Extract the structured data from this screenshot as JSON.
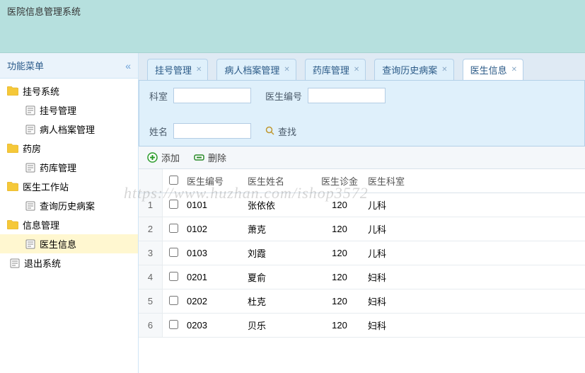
{
  "app_title": "医院信息管理系统",
  "sidebar": {
    "title": "功能菜单",
    "nodes": [
      {
        "label": "挂号系统",
        "type": "folder"
      },
      {
        "label": "挂号管理",
        "type": "leaf"
      },
      {
        "label": "病人档案管理",
        "type": "leaf"
      },
      {
        "label": "药房",
        "type": "folder"
      },
      {
        "label": "药库管理",
        "type": "leaf"
      },
      {
        "label": "医生工作站",
        "type": "folder"
      },
      {
        "label": "查询历史病案",
        "type": "leaf"
      },
      {
        "label": "信息管理",
        "type": "folder"
      },
      {
        "label": "医生信息",
        "type": "leaf",
        "selected": true
      },
      {
        "label": "退出系统",
        "type": "leaf-root"
      }
    ]
  },
  "tabs": [
    {
      "label": "挂号管理"
    },
    {
      "label": "病人档案管理"
    },
    {
      "label": "药库管理"
    },
    {
      "label": "查询历史病案"
    },
    {
      "label": "医生信息",
      "active": true
    }
  ],
  "filters": {
    "dept_label": "科室",
    "code_label": "医生编号",
    "name_label": "姓名",
    "search_label": "查找"
  },
  "toolbar": {
    "add_label": "添加",
    "del_label": "删除"
  },
  "grid": {
    "headers": {
      "code": "医生编号",
      "name": "医生姓名",
      "fee": "医生诊金",
      "dept": "医生科室"
    },
    "rows": [
      {
        "idx": "1",
        "code": "0101",
        "name": "张依依",
        "fee": "120",
        "dept": "儿科"
      },
      {
        "idx": "2",
        "code": "0102",
        "name": "萧克",
        "fee": "120",
        "dept": "儿科"
      },
      {
        "idx": "3",
        "code": "0103",
        "name": "刘霞",
        "fee": "120",
        "dept": "儿科"
      },
      {
        "idx": "4",
        "code": "0201",
        "name": "夏俞",
        "fee": "120",
        "dept": "妇科"
      },
      {
        "idx": "5",
        "code": "0202",
        "name": "杜克",
        "fee": "120",
        "dept": "妇科"
      },
      {
        "idx": "6",
        "code": "0203",
        "name": "贝乐",
        "fee": "120",
        "dept": "妇科"
      }
    ]
  },
  "watermark": "https://www.huzhan.com/ishop3572"
}
